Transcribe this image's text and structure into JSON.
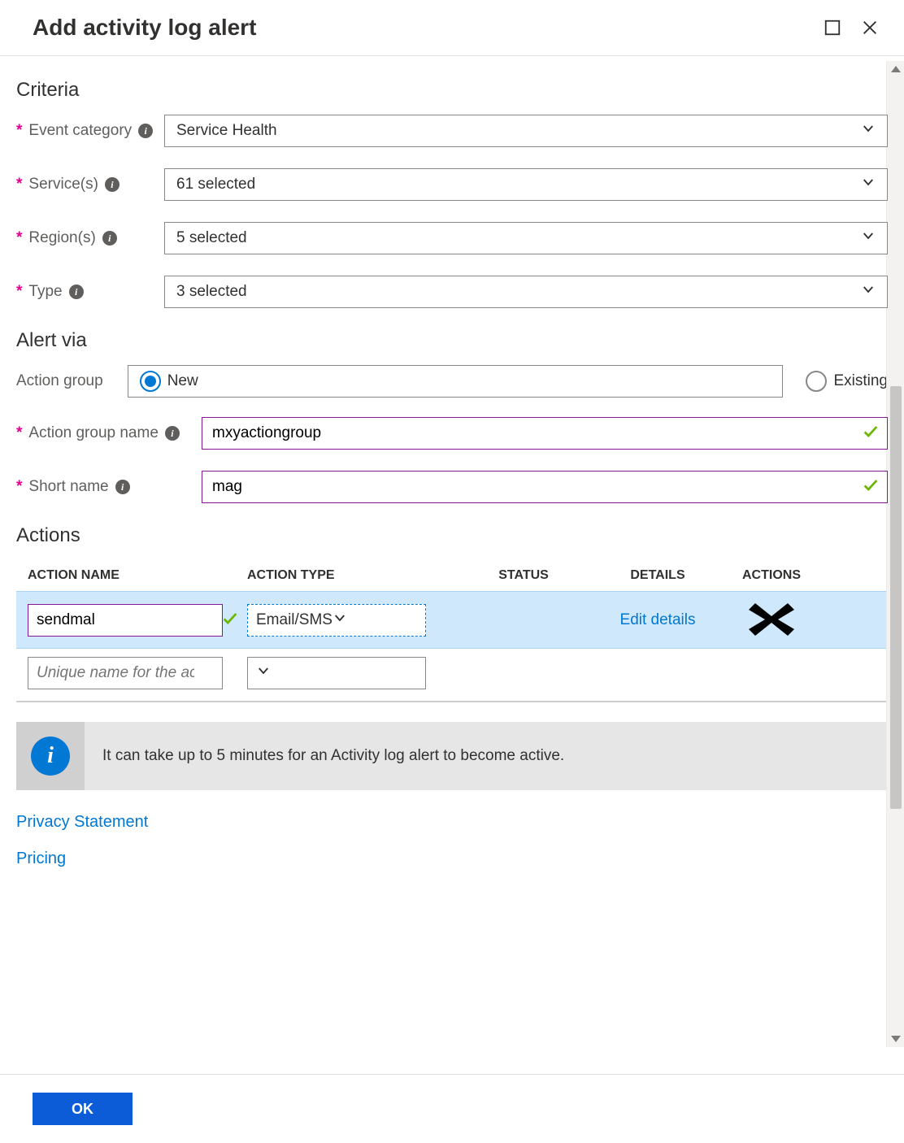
{
  "header": {
    "title": "Add activity log alert"
  },
  "criteria": {
    "heading": "Criteria",
    "event_category": {
      "label": "Event category",
      "value": "Service Health"
    },
    "services": {
      "label": "Service(s)",
      "value": "61 selected"
    },
    "regions": {
      "label": "Region(s)",
      "value": "5 selected"
    },
    "type": {
      "label": "Type",
      "value": "3 selected"
    }
  },
  "alert_via": {
    "heading": "Alert via",
    "action_group_label": "Action group",
    "radio_new": "New",
    "radio_existing": "Existing",
    "selected": "New",
    "action_group_name": {
      "label": "Action group name",
      "value": "mxyactiongroup"
    },
    "short_name": {
      "label": "Short name",
      "value": "mag"
    }
  },
  "actions": {
    "heading": "Actions",
    "columns": {
      "name": "ACTION NAME",
      "type": "ACTION TYPE",
      "status": "STATUS",
      "details": "DETAILS",
      "actions": "ACTIONS"
    },
    "rows": [
      {
        "name": "sendmal",
        "type": "Email/SMS",
        "status": "",
        "details_link": "Edit details"
      }
    ],
    "empty_row_placeholder": "Unique name for the acti"
  },
  "banner": {
    "message": "It can take up to 5 minutes for an Activity log alert to become active."
  },
  "links": {
    "privacy": "Privacy Statement",
    "pricing": "Pricing"
  },
  "footer": {
    "ok": "OK"
  }
}
